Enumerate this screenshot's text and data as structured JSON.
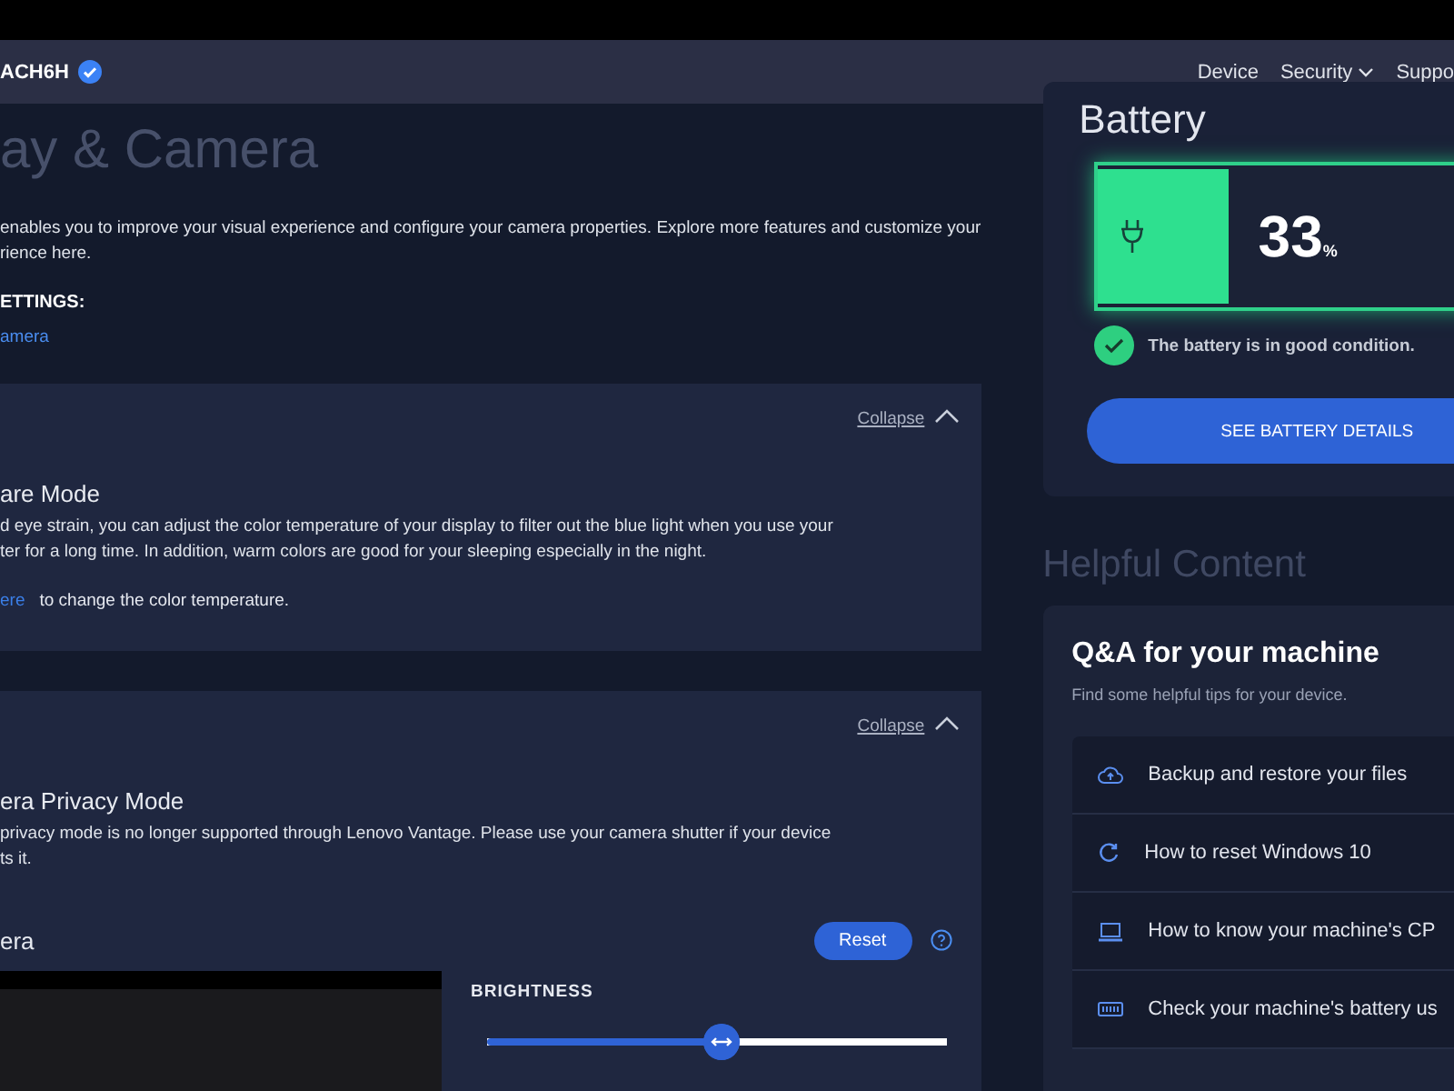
{
  "header": {
    "account": "ACH6H",
    "verified": true,
    "nav": [
      {
        "label": "Device",
        "kind": "link"
      },
      {
        "label": "Security",
        "kind": "dropdown"
      },
      {
        "label": "Suppo",
        "kind": "link"
      }
    ]
  },
  "page": {
    "title": "ay & Camera",
    "intro": [
      "enables you to improve your visual experience and configure your camera properties. Explore more features and customize your",
      "rience here."
    ],
    "settings_heading": "ETTINGS:",
    "settings_link": "amera"
  },
  "sections": [
    {
      "collapse": "Collapse",
      "expanded": true,
      "title": "are Mode",
      "lines": [
        "d eye strain, you can adjust the color temperature of your display to filter out the blue light when you use your",
        "ter for a long time. In addition, warm colors are good for your sleeping especially in the night."
      ],
      "link": "ere",
      "link_rest": "to change the color temperature."
    },
    {
      "collapse": "Collapse",
      "expanded": true,
      "title": "era Privacy Mode",
      "lines": [
        "privacy mode is no longer supported through Lenovo Vantage. Please use your camera shutter if your device",
        "ts it."
      ]
    }
  ],
  "camera": {
    "title": "era",
    "reset": "Reset",
    "brightness_label": "BRIGHTNESS",
    "level": 0.51
  },
  "battery": {
    "title": "Battery",
    "level": 0.33,
    "percent": "33",
    "unit": "%",
    "good": true,
    "status": "The battery is in good condition.",
    "details_button": "SEE BATTERY DETAILS"
  },
  "helpful": {
    "title": "Helpful Content",
    "qa_title": "Q&A for your machine",
    "qa_subtitle": "Find some helpful tips for your device.",
    "items": [
      {
        "kind": "backup",
        "label": "Backup and restore your files"
      },
      {
        "kind": "reset",
        "label": "How to reset Windows 10"
      },
      {
        "kind": "hardware",
        "label": "How to know your machine's CP"
      },
      {
        "kind": "power",
        "label": "Check your machine's battery us"
      }
    ]
  }
}
